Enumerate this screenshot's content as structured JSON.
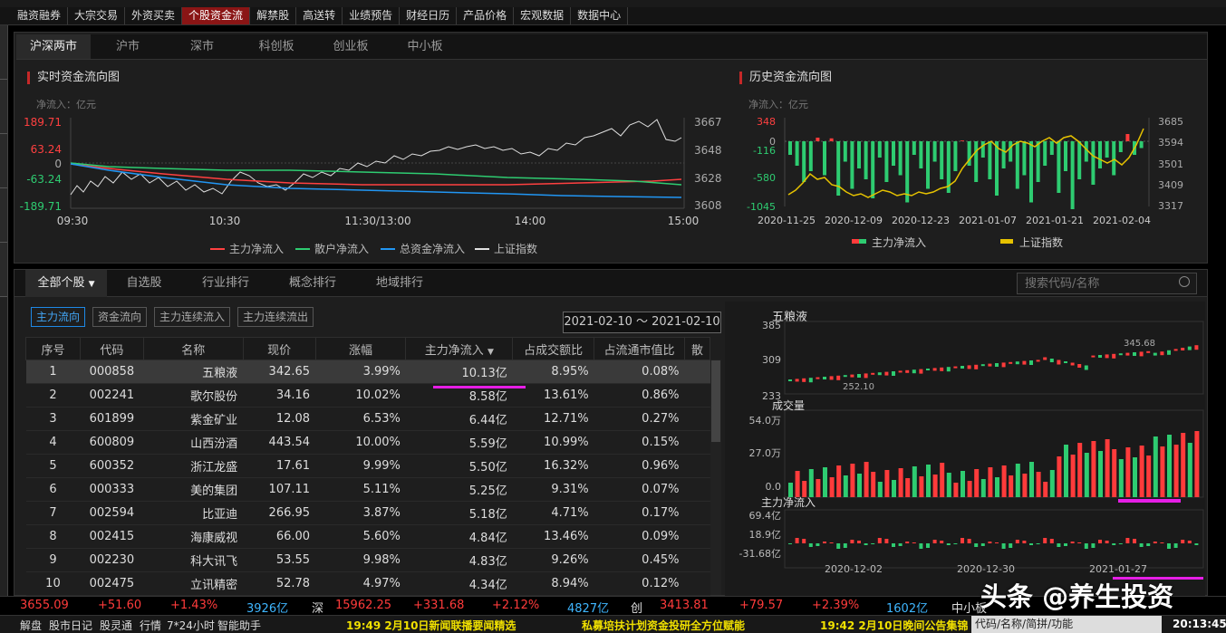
{
  "navbar": {
    "tabs": [
      "融资融券",
      "大宗交易",
      "外资买卖",
      "个股资金流",
      "解禁股",
      "高送转",
      "业绩预告",
      "财经日历",
      "产品价格",
      "宏观数据",
      "数据中心"
    ],
    "active_index": 3
  },
  "market_tabs": {
    "items": [
      "沪深两市",
      "沪市",
      "深市",
      "科创板",
      "创业板",
      "中小板"
    ],
    "active_index": 0
  },
  "realtime_chart": {
    "title": "实时资金流向图",
    "unit": "净流入：亿元",
    "y_left": [
      "189.71",
      "63.24",
      "0",
      "-63.24",
      "-189.71"
    ],
    "y_right": [
      "3667",
      "3648",
      "3628",
      "3608"
    ],
    "x": [
      "09:30",
      "10:30",
      "11:30/13:00",
      "14:00",
      "15:00"
    ],
    "legend": [
      "主力净流入",
      "散户净流入",
      "总资金净流入",
      "上证指数"
    ]
  },
  "history_chart": {
    "title": "历史资金流向图",
    "unit": "净流入：亿元",
    "y_left": [
      "348",
      "0",
      "-116",
      "-580",
      "-1045"
    ],
    "y_right": [
      "3685",
      "3594",
      "3501",
      "3409",
      "3317"
    ],
    "x": [
      "2020-11-25",
      "2020-12-09",
      "2020-12-23",
      "2021-01-07",
      "2021-01-21",
      "2021-02-04"
    ],
    "legend": [
      "主力净流入",
      "上证指数"
    ]
  },
  "stock_tabs": [
    "全部个股",
    "自选股",
    "行业排行",
    "概念排行",
    "地域排行"
  ],
  "search": {
    "placeholder": "搜索代码/名称"
  },
  "filters": [
    "主力流向",
    "资金流向",
    "主力连续流入",
    "主力连续流出"
  ],
  "date_range": "2021-02-10 ～ 2021-02-10",
  "table": {
    "headers": [
      "序号",
      "代码",
      "名称",
      "现价",
      "涨幅",
      "主力净流入",
      "占成交额比",
      "占流通市值比",
      "散"
    ],
    "rows": [
      [
        "1",
        "000858",
        "五粮液",
        "342.65",
        "3.99%",
        "10.13亿",
        "8.95%",
        "0.08%"
      ],
      [
        "2",
        "002241",
        "歌尔股份",
        "34.16",
        "10.02%",
        "8.58亿",
        "13.61%",
        "0.86%"
      ],
      [
        "3",
        "601899",
        "紫金矿业",
        "12.08",
        "6.53%",
        "6.44亿",
        "12.71%",
        "0.27%"
      ],
      [
        "4",
        "600809",
        "山西汾酒",
        "443.54",
        "10.00%",
        "5.59亿",
        "10.99%",
        "0.15%"
      ],
      [
        "5",
        "600352",
        "浙江龙盛",
        "17.61",
        "9.99%",
        "5.50亿",
        "16.32%",
        "0.96%"
      ],
      [
        "6",
        "000333",
        "美的集团",
        "107.11",
        "5.11%",
        "5.25亿",
        "9.31%",
        "0.07%"
      ],
      [
        "7",
        "002594",
        "比亚迪",
        "266.95",
        "3.87%",
        "5.18亿",
        "4.71%",
        "0.17%"
      ],
      [
        "8",
        "002415",
        "海康威视",
        "66.00",
        "5.60%",
        "4.84亿",
        "13.46%",
        "0.09%"
      ],
      [
        "9",
        "002230",
        "科大讯飞",
        "53.55",
        "9.98%",
        "4.83亿",
        "9.26%",
        "0.45%"
      ],
      [
        "10",
        "002475",
        "立讯精密",
        "52.78",
        "4.97%",
        "4.34亿",
        "8.94%",
        "0.12%"
      ]
    ]
  },
  "stock_chart": {
    "name": "五粮液",
    "price_ticks": [
      "385",
      "309",
      "233"
    ],
    "high_label": "345.68",
    "low_label": "252.10",
    "volume_title": "成交量",
    "volume_ticks": [
      "54.0万",
      "27.0万",
      "0.0"
    ],
    "flow_title": "主力净流入",
    "flow_ticks": [
      "69.4亿",
      "18.9亿",
      "-31.68亿"
    ],
    "dates": [
      "2020-12-02",
      "2020-12-30",
      "2021-01-27"
    ]
  },
  "ticker": {
    "sh_price": "3655.09",
    "sh_change": "+51.60",
    "sh_pct": "+1.43%",
    "sh_amount": "3926亿",
    "sz_label": "深",
    "sz_price": "15962.25",
    "sz_change": "+331.68",
    "sz_pct": "+2.12%",
    "sz_amount": "4827亿",
    "cy_label": "创",
    "cy_price": "3413.81",
    "cy_change": "+79.57",
    "cy_pct": "+2.39%",
    "cy_amount": "1602亿",
    "zx_label": "中小板"
  },
  "bottom": {
    "buttons": [
      "解盘",
      "股市日记",
      "股灵通",
      "行情",
      "7*24小时",
      "智能助手"
    ],
    "news": [
      "19:49 2月10日新闻联播要闻精选",
      "私募培扶计划资金投研全方位赋能",
      "19:42 2月10日晚间公告集锦"
    ],
    "search_placeholder": "代码/名称/简拼/功能",
    "time": "20:13:45"
  },
  "watermark": "头条 @养生投资"
}
